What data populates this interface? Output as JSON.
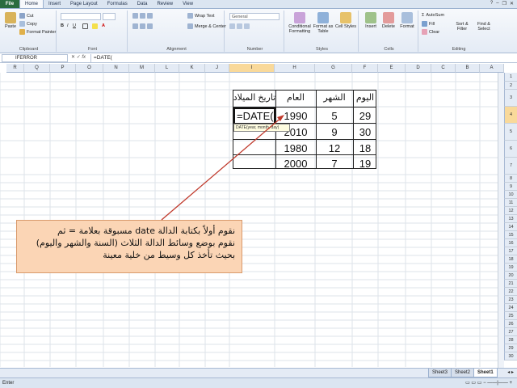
{
  "ribbon": {
    "tabs": [
      "File",
      "Home",
      "Insert",
      "Page Layout",
      "Formulas",
      "Data",
      "Review",
      "View"
    ],
    "active_tab": "Home",
    "clipboard": {
      "paste": "Paste",
      "cut": "Cut",
      "copy": "Copy",
      "format_painter": "Format Painter",
      "label": "Clipboard"
    },
    "font": {
      "label": "Font"
    },
    "alignment": {
      "wrap_text": "Wrap Text",
      "merge_center": "Merge & Center",
      "label": "Alignment"
    },
    "number": {
      "format": "General",
      "label": "Number"
    },
    "styles": {
      "conditional": "Conditional Formatting",
      "format_table": "Format as Table",
      "cell_styles": "Cell Styles",
      "label": "Styles"
    },
    "cells": {
      "insert": "Insert",
      "delete": "Delete",
      "format": "Format",
      "label": "Cells"
    },
    "editing": {
      "autosum": "AutoSum",
      "fill": "Fill",
      "clear": "Clear",
      "sort_filter": "Sort & Filter",
      "find_select": "Find & Select",
      "label": "Editing"
    }
  },
  "formula_bar": {
    "name_box": "IFERROR",
    "formula": "=DATE("
  },
  "columns": [
    "A",
    "B",
    "C",
    "D",
    "E",
    "F",
    "G",
    "H",
    "I",
    "J",
    "K",
    "L",
    "M",
    "N",
    "O",
    "P",
    "Q",
    "R"
  ],
  "active_column": "I",
  "rows": [
    "1",
    "2",
    "3",
    "4",
    "5",
    "6",
    "7",
    "8",
    "9",
    "10",
    "11",
    "12",
    "13",
    "14",
    "15",
    "16",
    "17",
    "18",
    "19",
    "20",
    "21",
    "22",
    "23",
    "24",
    "25",
    "26",
    "27",
    "28",
    "29",
    "30"
  ],
  "active_row": "4",
  "table": {
    "headers": {
      "day": "اليوم",
      "month": "الشهر",
      "year": "العام",
      "birth_date": "تاريخ الميلاد"
    },
    "active_entry": "=DATE(",
    "rows": [
      {
        "day": "29",
        "month": "5",
        "year": "1990"
      },
      {
        "day": "30",
        "month": "9",
        "year": "2010"
      },
      {
        "day": "18",
        "month": "12",
        "year": "1980"
      },
      {
        "day": "19",
        "month": "7",
        "year": "2000"
      }
    ]
  },
  "tooltip": "DATE(year, month, day)",
  "callout": {
    "line1": "نقوم أولاً بكتابة الدالة date مسبوقة بعلامة = ثم",
    "line2": "نقوم بوضع وسائط الدالة الثلاث (السنة والشهر واليوم)",
    "line3": "بحيث تأخذ كل وسيط من خلية معينة"
  },
  "sheets": [
    "Sheet3",
    "Sheet2",
    "Sheet1"
  ],
  "active_sheet": "Sheet1",
  "status": "Enter",
  "colors": {
    "callout_bg": "#fbd5b5",
    "arrow": "#c0392b",
    "file_tab": "#2a6c3f"
  }
}
